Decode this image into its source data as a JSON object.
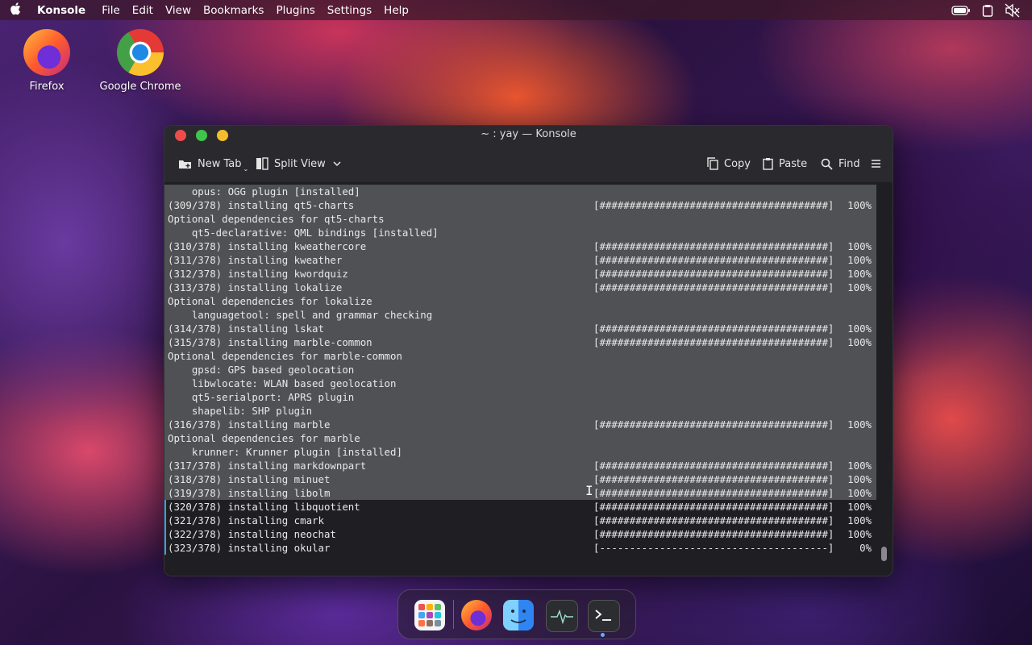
{
  "menubar": {
    "app_name": "Konsole",
    "menus": [
      "File",
      "Edit",
      "View",
      "Bookmarks",
      "Plugins",
      "Settings",
      "Help"
    ],
    "tray_icons": [
      "battery-icon",
      "clipboard-icon",
      "volume-muted-icon"
    ]
  },
  "desktop": {
    "icons": [
      {
        "label": "Firefox",
        "icon": "firefox-icon"
      },
      {
        "label": "Google Chrome",
        "icon": "chrome-icon"
      }
    ]
  },
  "window": {
    "title": "~ : yay — Konsole",
    "toolbar": {
      "new_tab": "New Tab",
      "split_view": "Split View",
      "copy": "Copy",
      "paste": "Paste",
      "find": "Find"
    }
  },
  "terminal": {
    "progress_bar_full": "[######################################]",
    "progress_bar_empty": "[--------------------------------------]",
    "lines": [
      {
        "text": "    opus: OGG plugin [installed]",
        "selected": true
      },
      {
        "text": "(309/378) installing qt5-charts",
        "progress": 100,
        "selected": true
      },
      {
        "text": "Optional dependencies for qt5-charts",
        "selected": true
      },
      {
        "text": "    qt5-declarative: QML bindings [installed]",
        "selected": true
      },
      {
        "text": "(310/378) installing kweathercore",
        "progress": 100,
        "selected": true
      },
      {
        "text": "(311/378) installing kweather",
        "progress": 100,
        "selected": true
      },
      {
        "text": "(312/378) installing kwordquiz",
        "progress": 100,
        "selected": true
      },
      {
        "text": "(313/378) installing lokalize",
        "progress": 100,
        "selected": true
      },
      {
        "text": "Optional dependencies for lokalize",
        "selected": true
      },
      {
        "text": "    languagetool: spell and grammar checking",
        "selected": true
      },
      {
        "text": "(314/378) installing lskat",
        "progress": 100,
        "selected": true
      },
      {
        "text": "(315/378) installing marble-common",
        "progress": 100,
        "selected": true
      },
      {
        "text": "Optional dependencies for marble-common",
        "selected": true
      },
      {
        "text": "    gpsd: GPS based geolocation",
        "selected": true
      },
      {
        "text": "    libwlocate: WLAN based geolocation",
        "selected": true
      },
      {
        "text": "    qt5-serialport: APRS plugin",
        "selected": true
      },
      {
        "text": "    shapelib: SHP plugin",
        "selected": true
      },
      {
        "text": "(316/378) installing marble",
        "progress": 100,
        "selected": true
      },
      {
        "text": "Optional dependencies for marble",
        "selected": true
      },
      {
        "text": "    krunner: Krunner plugin [installed]",
        "selected": true
      },
      {
        "text": "(317/378) installing markdownpart",
        "progress": 100,
        "selected": true
      },
      {
        "text": "(318/378) installing minuet",
        "progress": 100,
        "selected": true
      },
      {
        "text": "(319/378) installing libolm",
        "progress": 100,
        "selected": true
      },
      {
        "text": "(320/378) installing libquotient",
        "progress": 100,
        "selected": false
      },
      {
        "text": "(321/378) installing cmark",
        "progress": 100,
        "selected": false
      },
      {
        "text": "(322/378) installing neochat",
        "progress": 100,
        "selected": false
      },
      {
        "text": "(323/378) installing okular",
        "progress": 0,
        "selected": false
      }
    ]
  },
  "dock": {
    "items": [
      "app-launcher-icon",
      "firefox-icon",
      "finder-icon",
      "system-monitor-icon",
      "konsole-icon"
    ]
  }
}
